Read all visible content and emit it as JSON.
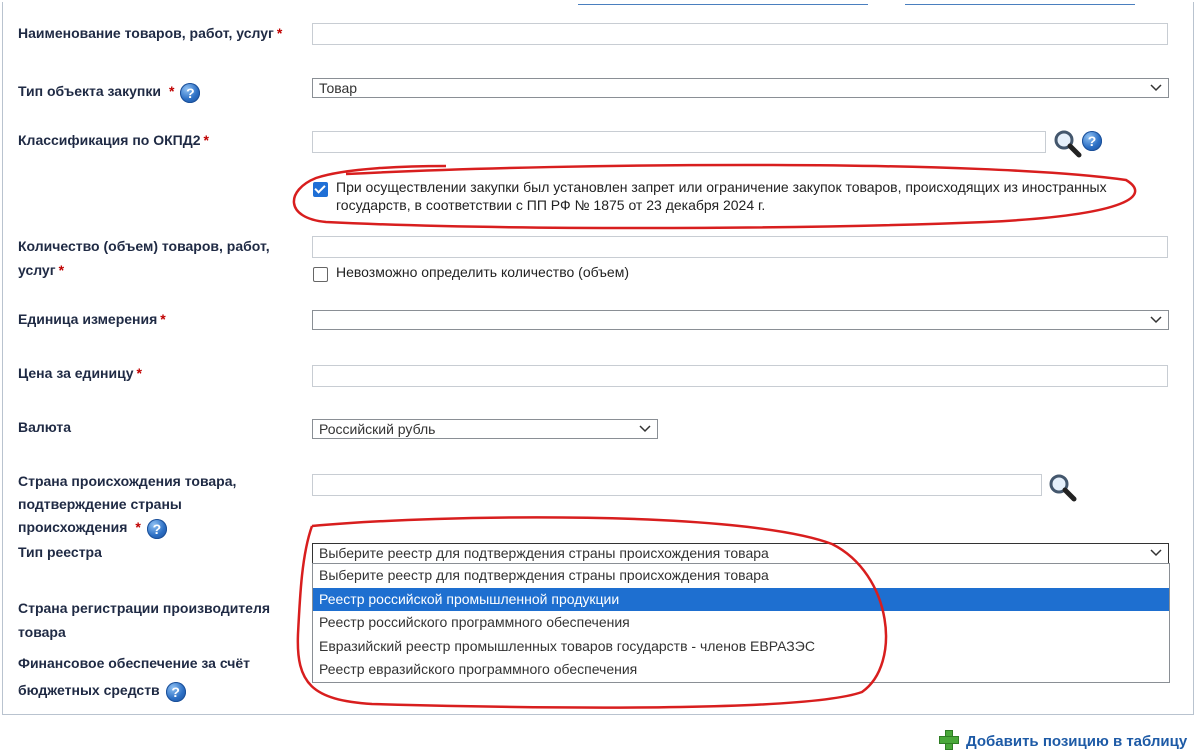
{
  "form": {
    "name": {
      "label": "Наименование товаров, работ, услуг",
      "required": "*",
      "value": ""
    },
    "object_type": {
      "label": "Тип объекта закупки",
      "required": "*",
      "help": "?",
      "selected": "Товар"
    },
    "okpd2": {
      "label": "Классификация по ОКПД2",
      "required": "*",
      "value": "",
      "help": "?"
    },
    "restriction_checkbox": {
      "checked": true,
      "text_line1": "При осуществлении закупки был установлен запрет или ограничение закупок товаров, происходящих из иностранных",
      "text_line2": "государств, в соответствии с ПП РФ № 1875 от 23 декабря 2024 г."
    },
    "quantity": {
      "label_line1": "Количество (объем) товаров, работ,",
      "label_line2": "услуг",
      "required": "*",
      "value": ""
    },
    "quantity_checkbox": {
      "checked": false,
      "text": "Невозможно определить количество (объем)"
    },
    "unit": {
      "label": "Единица измерения",
      "required": "*",
      "selected": ""
    },
    "price": {
      "label": "Цена за единицу",
      "required": "*",
      "value": ""
    },
    "currency": {
      "label": "Валюта",
      "selected": "Российский рубль"
    },
    "origin_country": {
      "label_line1": "Страна происхождения товара,",
      "label_line2": "подтверждение страны",
      "label_line3": "происхождения",
      "required": "*",
      "help": "?",
      "value": ""
    },
    "registry_type": {
      "label": "Тип реестра",
      "selected": "Выберите реестр для подтверждения страны происхождения товара",
      "options": [
        "Выберите реестр для подтверждения страны происхождения товара",
        "Реестр российской промышленной продукции",
        "Реестр российского программного обеспечения",
        "Евразийский реестр промышленных товаров государств - членов ЕВРАЗЭС",
        "Реестр евразийского программного обеспечения"
      ],
      "highlighted_index": 1
    },
    "manufacturer_country": {
      "label_line1": "Страна регистрации производителя",
      "label_line2": "товара"
    },
    "financing": {
      "label_line1": "Финансовое обеспечение за счёт",
      "label_line2": "бюджетных средств",
      "help": "?"
    }
  },
  "actions": {
    "add_position": "Добавить позицию в таблицу"
  },
  "colors": {
    "accent": "#1e6fd0",
    "required": "#c00000",
    "annotation": "#d81e1e",
    "link": "#1d5aa6"
  }
}
